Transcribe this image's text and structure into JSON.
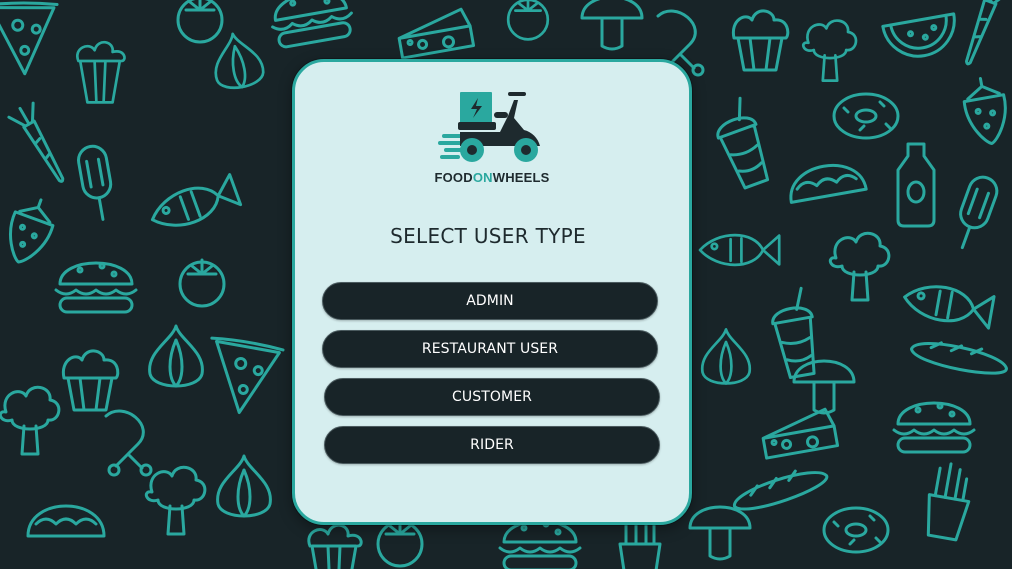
{
  "theme": {
    "background_color": "#182428",
    "doodle_color": "#2aa89f",
    "card_color": "#d6eeef",
    "card_border_color": "#2aa89f",
    "button_color": "#182428",
    "button_text_color": "#ffffff",
    "title_color": "#1e2a2e",
    "logo_dark_color": "#1e2a2e",
    "logo_accent_color": "#2aa89f"
  },
  "logo": {
    "icon": "delivery-scooter-icon",
    "word_food": "FOOD",
    "word_on": "ON",
    "word_wheels": "WHEELS"
  },
  "title": "SELECT USER TYPE",
  "options": [
    {
      "label": "ADMIN"
    },
    {
      "label": "RESTAURANT USER"
    },
    {
      "label": "CUSTOMER"
    },
    {
      "label": "RIDER"
    }
  ],
  "background_icons": [
    "pizza-icon",
    "popcorn-icon",
    "carrot-icon",
    "ice-cream-icon",
    "fish-icon",
    "burger-icon",
    "cheese-icon",
    "tomato-icon",
    "muffin-icon",
    "broccoli-icon",
    "donut-icon",
    "bottle-icon",
    "strawberry-icon",
    "watermelon-icon",
    "taco-icon",
    "mushroom-icon",
    "bread-icon",
    "fries-icon",
    "garlic-icon",
    "drumstick-icon"
  ]
}
